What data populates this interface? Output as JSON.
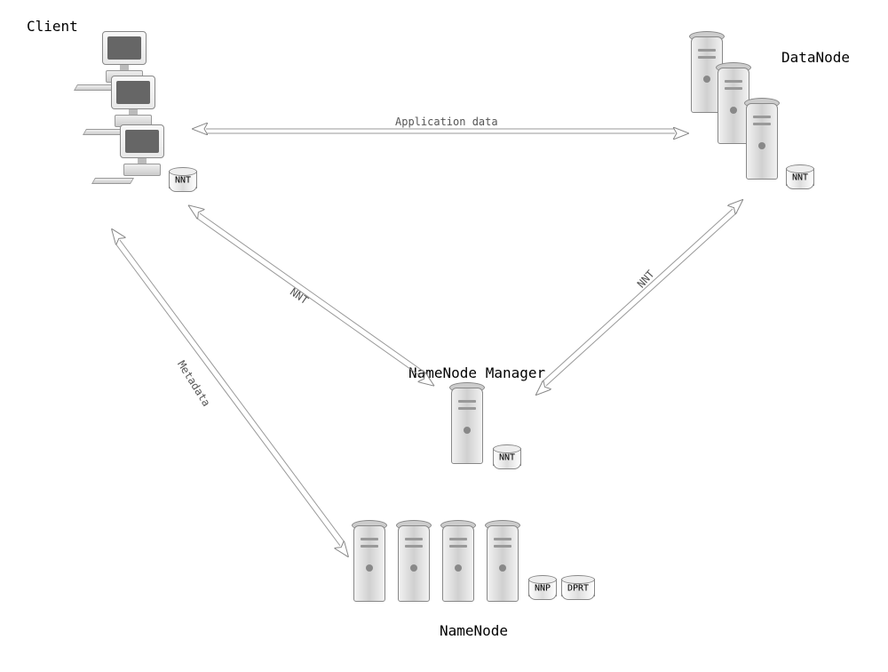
{
  "nodes": {
    "client": {
      "label": "Client",
      "badge": "NNT"
    },
    "datanode": {
      "label": "DataNode",
      "badge": "NNT"
    },
    "manager": {
      "label": "NameNode Manager",
      "badge": "NNT"
    },
    "namenode": {
      "label": "NameNode",
      "badge1": "NNP",
      "badge2": "DPRT"
    }
  },
  "connections": {
    "client_datanode": "Application data",
    "client_manager": "NNT",
    "client_namenode": "Metadata",
    "datanode_manager": "NNT"
  }
}
